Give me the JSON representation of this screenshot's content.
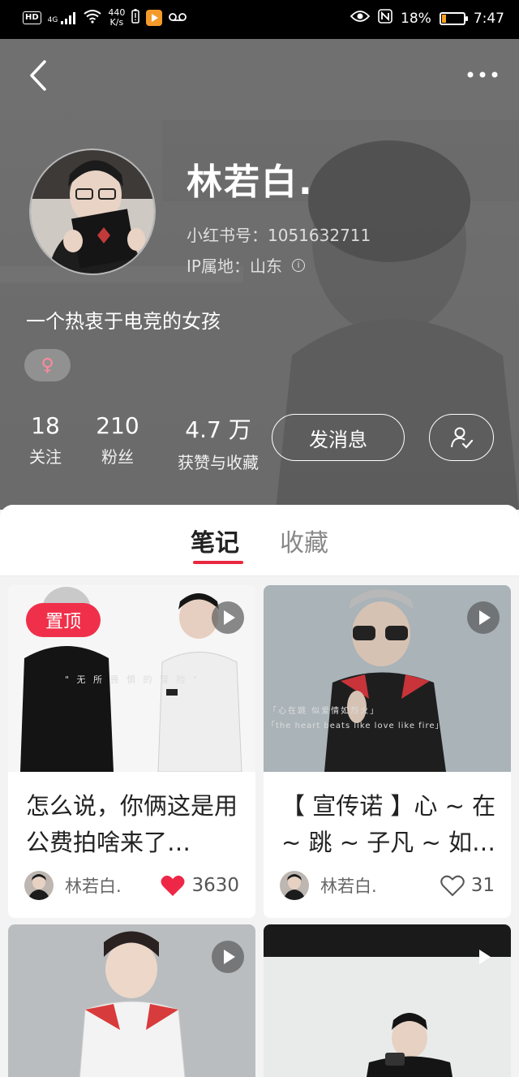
{
  "status_bar": {
    "hd": "HD",
    "signal": "4G",
    "net_speed_value": "440",
    "net_speed_unit": "K/s",
    "battery_percent": "18%",
    "battery_level": 0.18,
    "time": "7:47"
  },
  "profile": {
    "name": "林若白.",
    "xhs_id": "小红书号：1051632711",
    "ip_location": "IP属地：山东",
    "bio": "一个热衷于电竞的女孩",
    "gender_symbol": "♀",
    "stats": [
      {
        "value": "18",
        "label": "关注"
      },
      {
        "value": "210",
        "label": "粉丝"
      },
      {
        "value": "4.7 万",
        "label": "获赞与收藏"
      }
    ],
    "message_button": "发消息"
  },
  "tabs": [
    {
      "label": "笔记",
      "active": true
    },
    {
      "label": "收藏",
      "active": false
    }
  ],
  "notes": [
    {
      "pinned_label": "置顶",
      "cover_caption": "\" 无 所 畏 惧 的 冒 险 \"",
      "title": "怎么说，你俩这是用公费拍啥来了…",
      "author": "林若白.",
      "likes": "3630",
      "liked": true
    },
    {
      "cover_caption_1": "「心在跳 似爱情如烈火」",
      "cover_caption_2": "「the heart beats like love like fire」",
      "title": "【 宣传诺 】心 ~ 在 ~ 跳 ~ 子凡 ~ 如…",
      "author": "林若白.",
      "likes": "31",
      "liked": false
    },
    {
      "title": "",
      "author": ""
    },
    {
      "title": "",
      "author": ""
    }
  ],
  "colors": {
    "accent": "#e8283f",
    "pin_badge": "#f0304a",
    "header_bg": "#6e6e6e",
    "battery": "#f4a21d"
  },
  "icons": {
    "back": "chevron-left-icon",
    "more": "more-dots-icon",
    "follow": "user-check-icon",
    "info": "info-icon",
    "play": "play-icon",
    "like": "heart-icon"
  }
}
